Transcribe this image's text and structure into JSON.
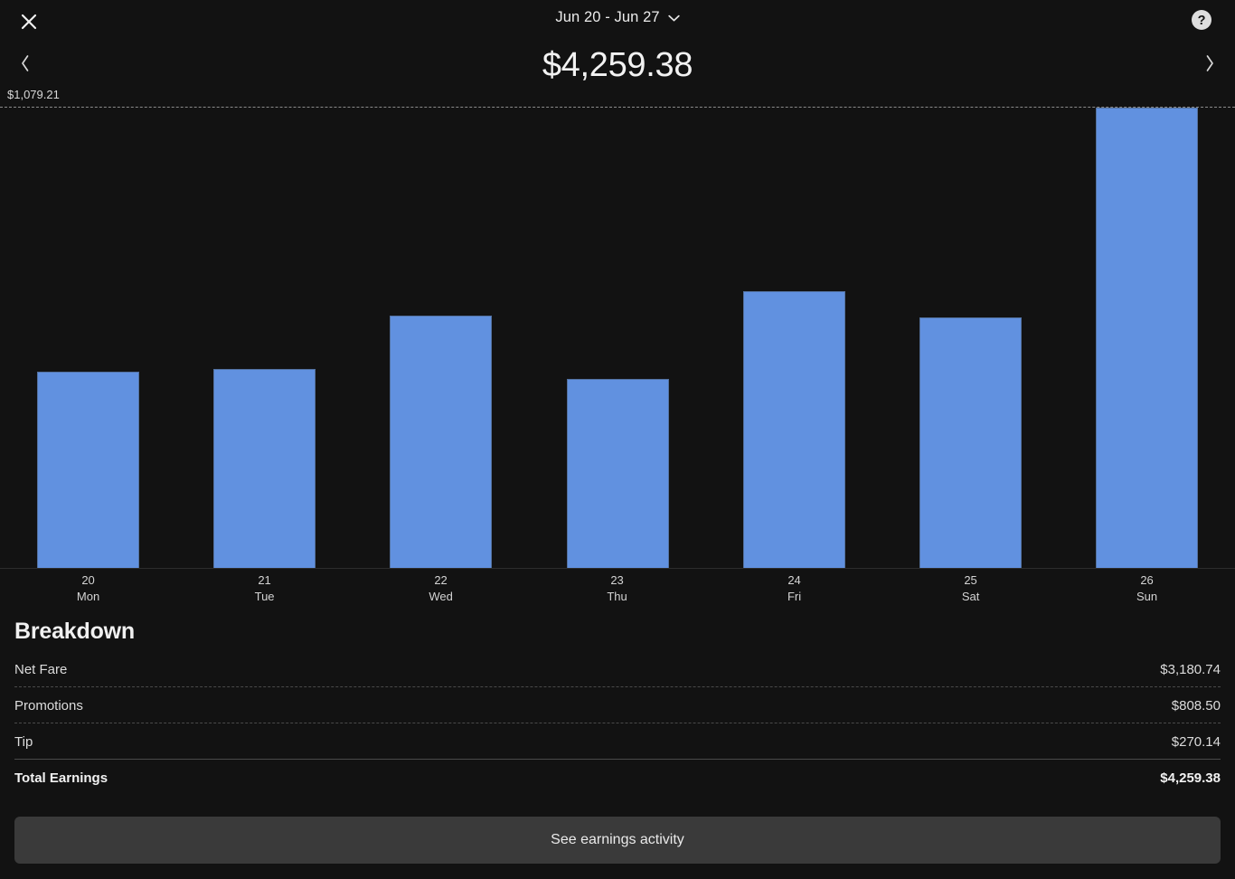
{
  "header": {
    "close_icon": "close-icon",
    "date_range": "Jun 20 - Jun 27",
    "chevron_icon": "chevron-down-icon",
    "help_icon": "help-circle-icon",
    "prev_icon": "chevron-left-icon",
    "next_icon": "chevron-right-icon",
    "total_amount": "$4,259.38"
  },
  "chart_data": {
    "type": "bar",
    "title": "",
    "subtitle": "",
    "xlabel": "",
    "ylabel": "",
    "gridline_label": "$1,079.21",
    "gridline_value": 1079.21,
    "ylim": [
      0,
      1079.21
    ],
    "grid": true,
    "legend": false,
    "bar_color": "#6191E0",
    "categories": [
      "20 Mon",
      "21 Tue",
      "22 Wed",
      "23 Thu",
      "24 Fri",
      "25 Sat",
      "26 Sun"
    ],
    "day_numbers": [
      "20",
      "21",
      "22",
      "23",
      "24",
      "25",
      "26"
    ],
    "day_names": [
      "Mon",
      "Tue",
      "Wed",
      "Thu",
      "Fri",
      "Sat",
      "Sun"
    ],
    "values": [
      460.2,
      466.6,
      591.7,
      443.2,
      648.9,
      587.4,
      1079.21
    ]
  },
  "breakdown": {
    "title": "Breakdown",
    "rows": [
      {
        "label": "Net Fare",
        "value": "$3,180.74"
      },
      {
        "label": "Promotions",
        "value": "$808.50"
      },
      {
        "label": "Tip",
        "value": "$270.14"
      },
      {
        "label": "Total Earnings",
        "value": "$4,259.38"
      }
    ]
  },
  "footer": {
    "cta_label": "See earnings activity"
  },
  "colors": {
    "background": "#121212",
    "bar": "#6191E0",
    "cta_background": "#3a3a3a",
    "text": "#e8e8e8"
  }
}
